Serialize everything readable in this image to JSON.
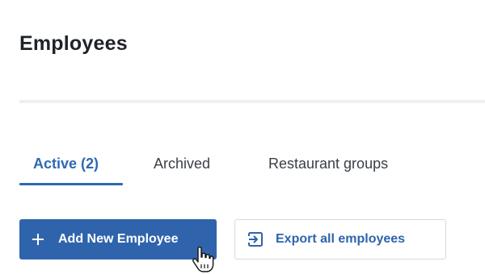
{
  "header": {
    "title": "Employees"
  },
  "tabs": [
    {
      "label": "Active (2)",
      "active": true
    },
    {
      "label": "Archived",
      "active": false
    },
    {
      "label": "Restaurant groups",
      "active": false
    }
  ],
  "actions": {
    "add_label": "Add New Employee",
    "add_icon": "plus-icon",
    "export_label": "Export all employees",
    "export_icon": "export-icon"
  },
  "colors": {
    "accent": "#2f64ad",
    "text": "#1f2328",
    "divider": "#eeeff1"
  },
  "cursor": {
    "icon": "hand-pointer-cursor"
  }
}
